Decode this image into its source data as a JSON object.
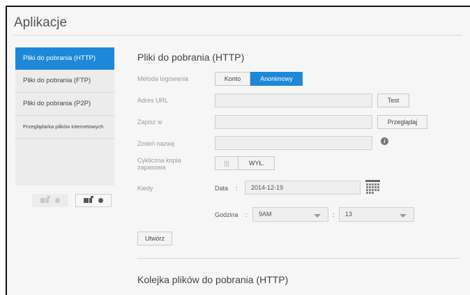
{
  "app": {
    "title": "Aplikacje"
  },
  "sidebar": {
    "items": [
      {
        "label": "Pliki do pobrania (HTTP)"
      },
      {
        "label": "Pliki do pobrania (FTP)"
      },
      {
        "label": "Pliki do pobrania (P2P)"
      },
      {
        "label": "Przeglądarka plików internetowych"
      }
    ],
    "view_buttons": [
      {
        "icon": "grid-remove-icon"
      },
      {
        "icon": "grid-add-icon"
      }
    ]
  },
  "main": {
    "section_title": "Pliki do pobrania (HTTP)",
    "login_method": {
      "label": "Metoda logowania",
      "options": [
        "Konto",
        "Anonimowy"
      ],
      "selected": "Anonimowy"
    },
    "url": {
      "label": "Adres URL",
      "value": "",
      "test_button": "Test"
    },
    "save_to": {
      "label": "Zapisz w",
      "value": "",
      "browse_button": "Przeglądaj"
    },
    "rename": {
      "label": "Zmień nazwę",
      "value": "",
      "info_icon": "info-icon"
    },
    "backup": {
      "label_line1": "Cykliczna kopia",
      "label_line2": "zapasowa",
      "grip": "|||",
      "toggle_value": "WYŁ."
    },
    "when": {
      "label": "Kiedy",
      "date_label": "Data",
      "date_sep": ":",
      "date_value": "2014-12-19",
      "time_label": "Godzina",
      "time_sep": ":",
      "hour_value": "9AM",
      "minute_sep": ":",
      "minute_value": "13"
    },
    "create_button": "Utwórz",
    "queue_title": "Kolejka plików do pobrania (HTTP)"
  },
  "colors": {
    "accent": "#1e88d8",
    "panel": "#f6f6f6"
  }
}
